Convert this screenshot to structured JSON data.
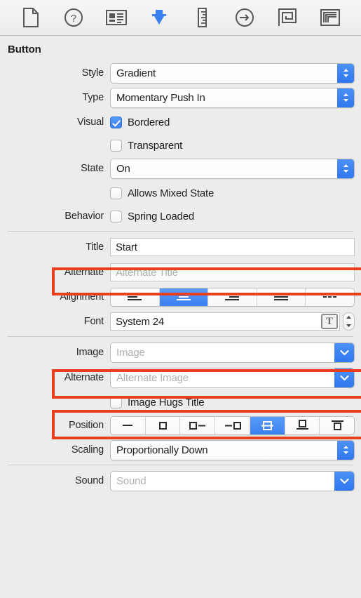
{
  "toolbar": {
    "items": [
      {
        "name": "file-inspector-icon",
        "title": "File Inspector"
      },
      {
        "name": "quick-help-inspector-icon",
        "title": "Quick Help Inspector"
      },
      {
        "name": "identity-inspector-icon",
        "title": "Identity Inspector"
      },
      {
        "name": "attributes-inspector-icon",
        "title": "Attributes Inspector"
      },
      {
        "name": "size-inspector-icon",
        "title": "Size Inspector"
      },
      {
        "name": "connections-inspector-icon",
        "title": "Connections Inspector"
      },
      {
        "name": "bindings-inspector-icon",
        "title": "Bindings Inspector"
      },
      {
        "name": "view-effects-inspector-icon",
        "title": "View Effects Inspector"
      }
    ],
    "selected_index": 3,
    "selected_color": "#3a80f0"
  },
  "inspector": {
    "section_title": "Button",
    "rows": {
      "style": {
        "label": "Style",
        "value": "Gradient"
      },
      "type": {
        "label": "Type",
        "value": "Momentary Push In"
      },
      "visual": {
        "label": "Visual",
        "bordered": {
          "label": "Bordered",
          "checked": true
        },
        "transparent": {
          "label": "Transparent",
          "checked": false
        }
      },
      "state": {
        "label": "State",
        "value": "On"
      },
      "allows_mixed_state": {
        "label": "Allows Mixed State",
        "checked": false
      },
      "behavior": {
        "label": "Behavior",
        "spring_loaded": {
          "label": "Spring Loaded",
          "checked": false
        }
      },
      "title": {
        "label": "Title",
        "value": "Start",
        "highlighted": true
      },
      "alternate_title": {
        "label": "Alternate",
        "placeholder": "Alternate Title"
      },
      "alignment": {
        "label": "Alignment",
        "options": [
          "align-left",
          "align-center",
          "align-right",
          "align-justify",
          "align-natural"
        ],
        "selected_index": 1
      },
      "font": {
        "label": "Font",
        "value": "System 24",
        "highlighted": true
      },
      "image": {
        "label": "Image",
        "placeholder": "Image",
        "highlighted": true
      },
      "alternate_image": {
        "label": "Alternate",
        "placeholder": "Alternate Image"
      },
      "image_hugs_title": {
        "label": "Image Hugs Title",
        "checked": false
      },
      "position": {
        "label": "Position",
        "options": [
          "title-only",
          "image-only",
          "image-left",
          "image-right",
          "image-overlaps",
          "image-above",
          "image-below"
        ],
        "selected_index": 4
      },
      "scaling": {
        "label": "Scaling",
        "value": "Proportionally Down"
      },
      "sound": {
        "label": "Sound",
        "placeholder": "Sound"
      }
    }
  },
  "colors": {
    "accent": "#3a80f0",
    "highlight": "#e8401f",
    "panel_bg": "#ececec",
    "text": "#1d1d1f",
    "placeholder": "#b0b0b0"
  }
}
